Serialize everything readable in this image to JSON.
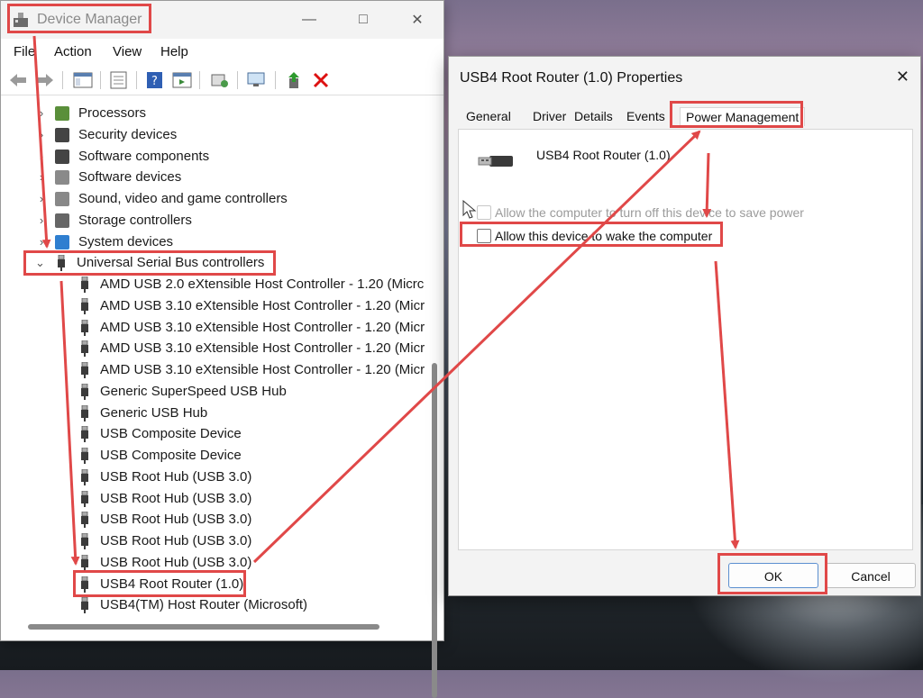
{
  "device_manager": {
    "title": "Device Manager",
    "menu": [
      "File",
      "Action",
      "View",
      "Help"
    ],
    "tree": {
      "categories_before": [
        {
          "label": "Processors",
          "icon": "processor-icon"
        },
        {
          "label": "Security devices",
          "icon": "security-device-icon"
        },
        {
          "label": "Software components",
          "icon": "software-component-icon"
        },
        {
          "label": "Software devices",
          "icon": "software-device-icon"
        },
        {
          "label": "Sound, video and game controllers",
          "icon": "speaker-icon"
        },
        {
          "label": "Storage controllers",
          "icon": "storage-controller-icon"
        },
        {
          "label": "System devices",
          "icon": "system-device-icon"
        }
      ],
      "expanded_category": {
        "label": "Universal Serial Bus controllers",
        "icon": "usb-icon"
      },
      "usb_children": [
        "AMD USB 2.0 eXtensible Host Controller - 1.20 (Micrc",
        "AMD USB 3.10 eXtensible Host Controller - 1.20 (Micr",
        "AMD USB 3.10 eXtensible Host Controller - 1.20 (Micr",
        "AMD USB 3.10 eXtensible Host Controller - 1.20 (Micr",
        "AMD USB 3.10 eXtensible Host Controller - 1.20 (Micr",
        "Generic SuperSpeed USB Hub",
        "Generic USB Hub",
        "USB Composite Device",
        "USB Composite Device",
        "USB Root Hub (USB 3.0)",
        "USB Root Hub (USB 3.0)",
        "USB Root Hub (USB 3.0)",
        "USB Root Hub (USB 3.0)",
        "USB Root Hub (USB 3.0)",
        "USB4 Root Router (1.0)",
        "USB4(TM) Host Router (Microsoft)"
      ]
    }
  },
  "properties_dialog": {
    "title": "USB4 Root Router (1.0) Properties",
    "tabs": [
      "General",
      "Driver",
      "Details",
      "Events",
      "Power Management"
    ],
    "active_tab": "Power Management",
    "device_name": "USB4 Root Router (1.0)",
    "options": [
      {
        "label": "Allow the computer to turn off this device to save power",
        "checked": false,
        "enabled": false
      },
      {
        "label": "Allow this device to wake the computer",
        "checked": false,
        "enabled": true
      }
    ],
    "ok_label": "OK",
    "cancel_label": "Cancel"
  },
  "colors": {
    "highlight": "#e04848",
    "accent": "#5b8fd0"
  }
}
